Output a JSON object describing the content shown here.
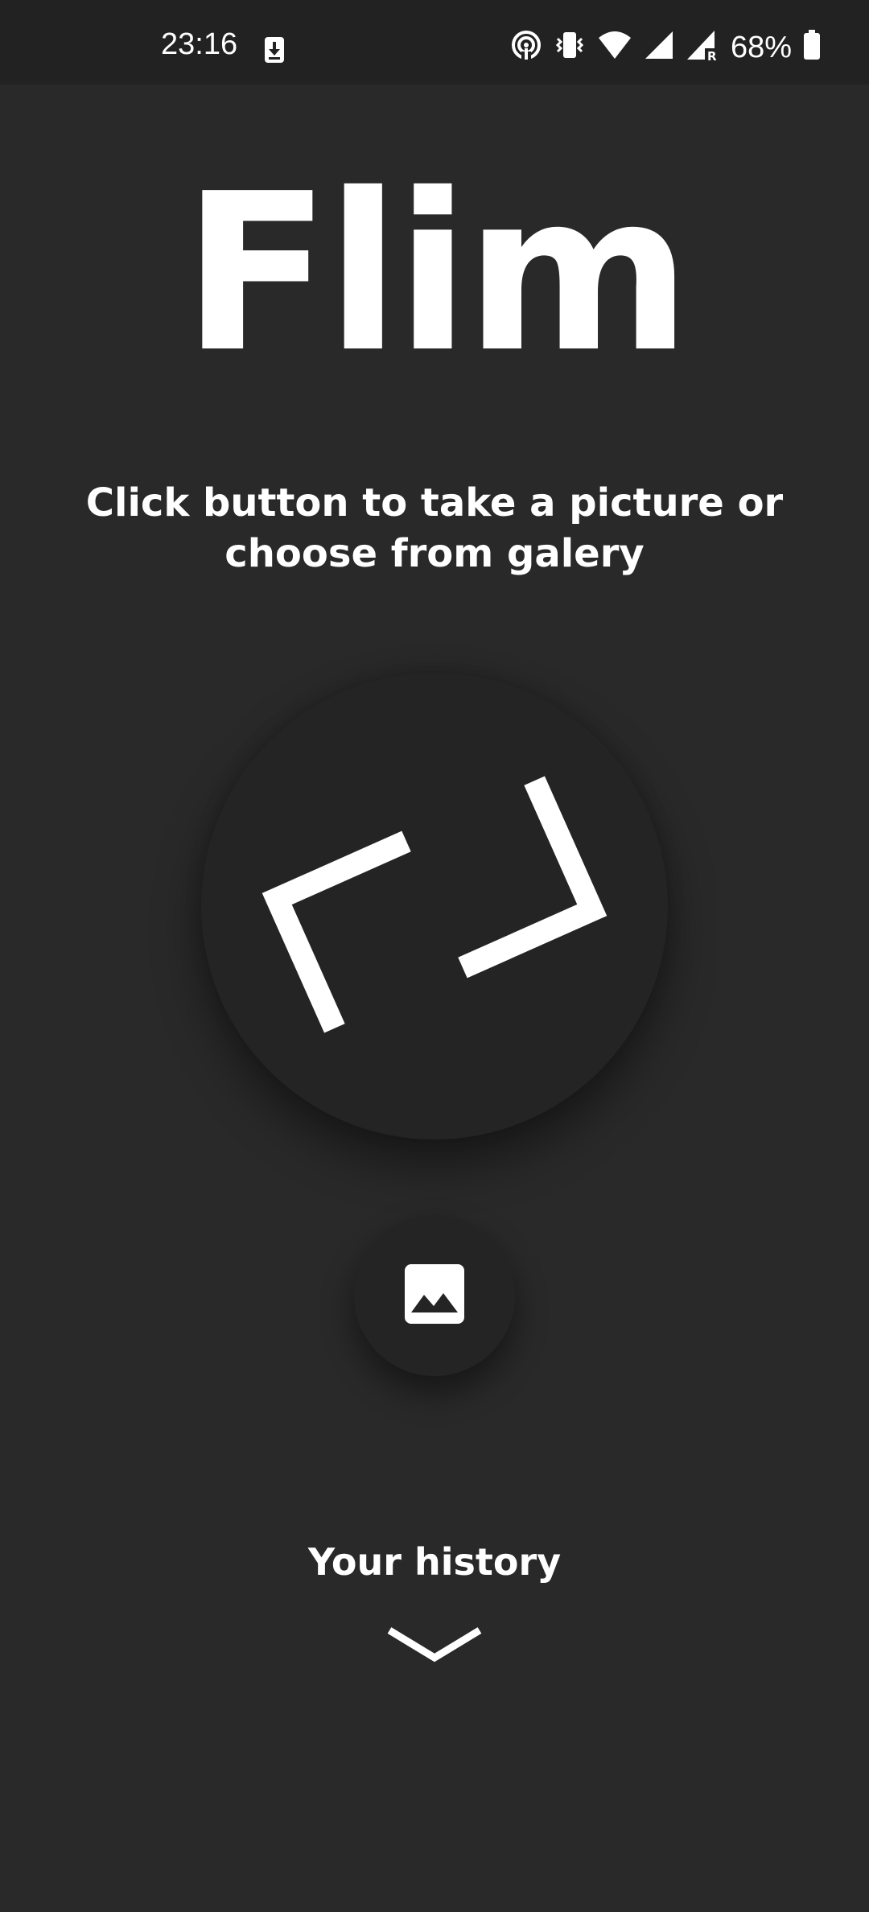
{
  "status_bar": {
    "time": "23:16",
    "battery_percent": "68%",
    "icons": [
      "download-icon",
      "hotspot-icon",
      "vibrate-icon",
      "wifi-icon",
      "signal-icon",
      "signal-roaming-icon",
      "battery-icon"
    ]
  },
  "app": {
    "title": "Flim",
    "subtitle": "Click button to take a picture or choose from galery"
  },
  "actions": {
    "capture_icon": "viewfinder-icon",
    "gallery_icon": "image-icon"
  },
  "history": {
    "label": "Your history",
    "icon": "chevron-down-icon"
  },
  "colors": {
    "background": "#292929",
    "button": "#242424",
    "foreground": "#ffffff"
  }
}
